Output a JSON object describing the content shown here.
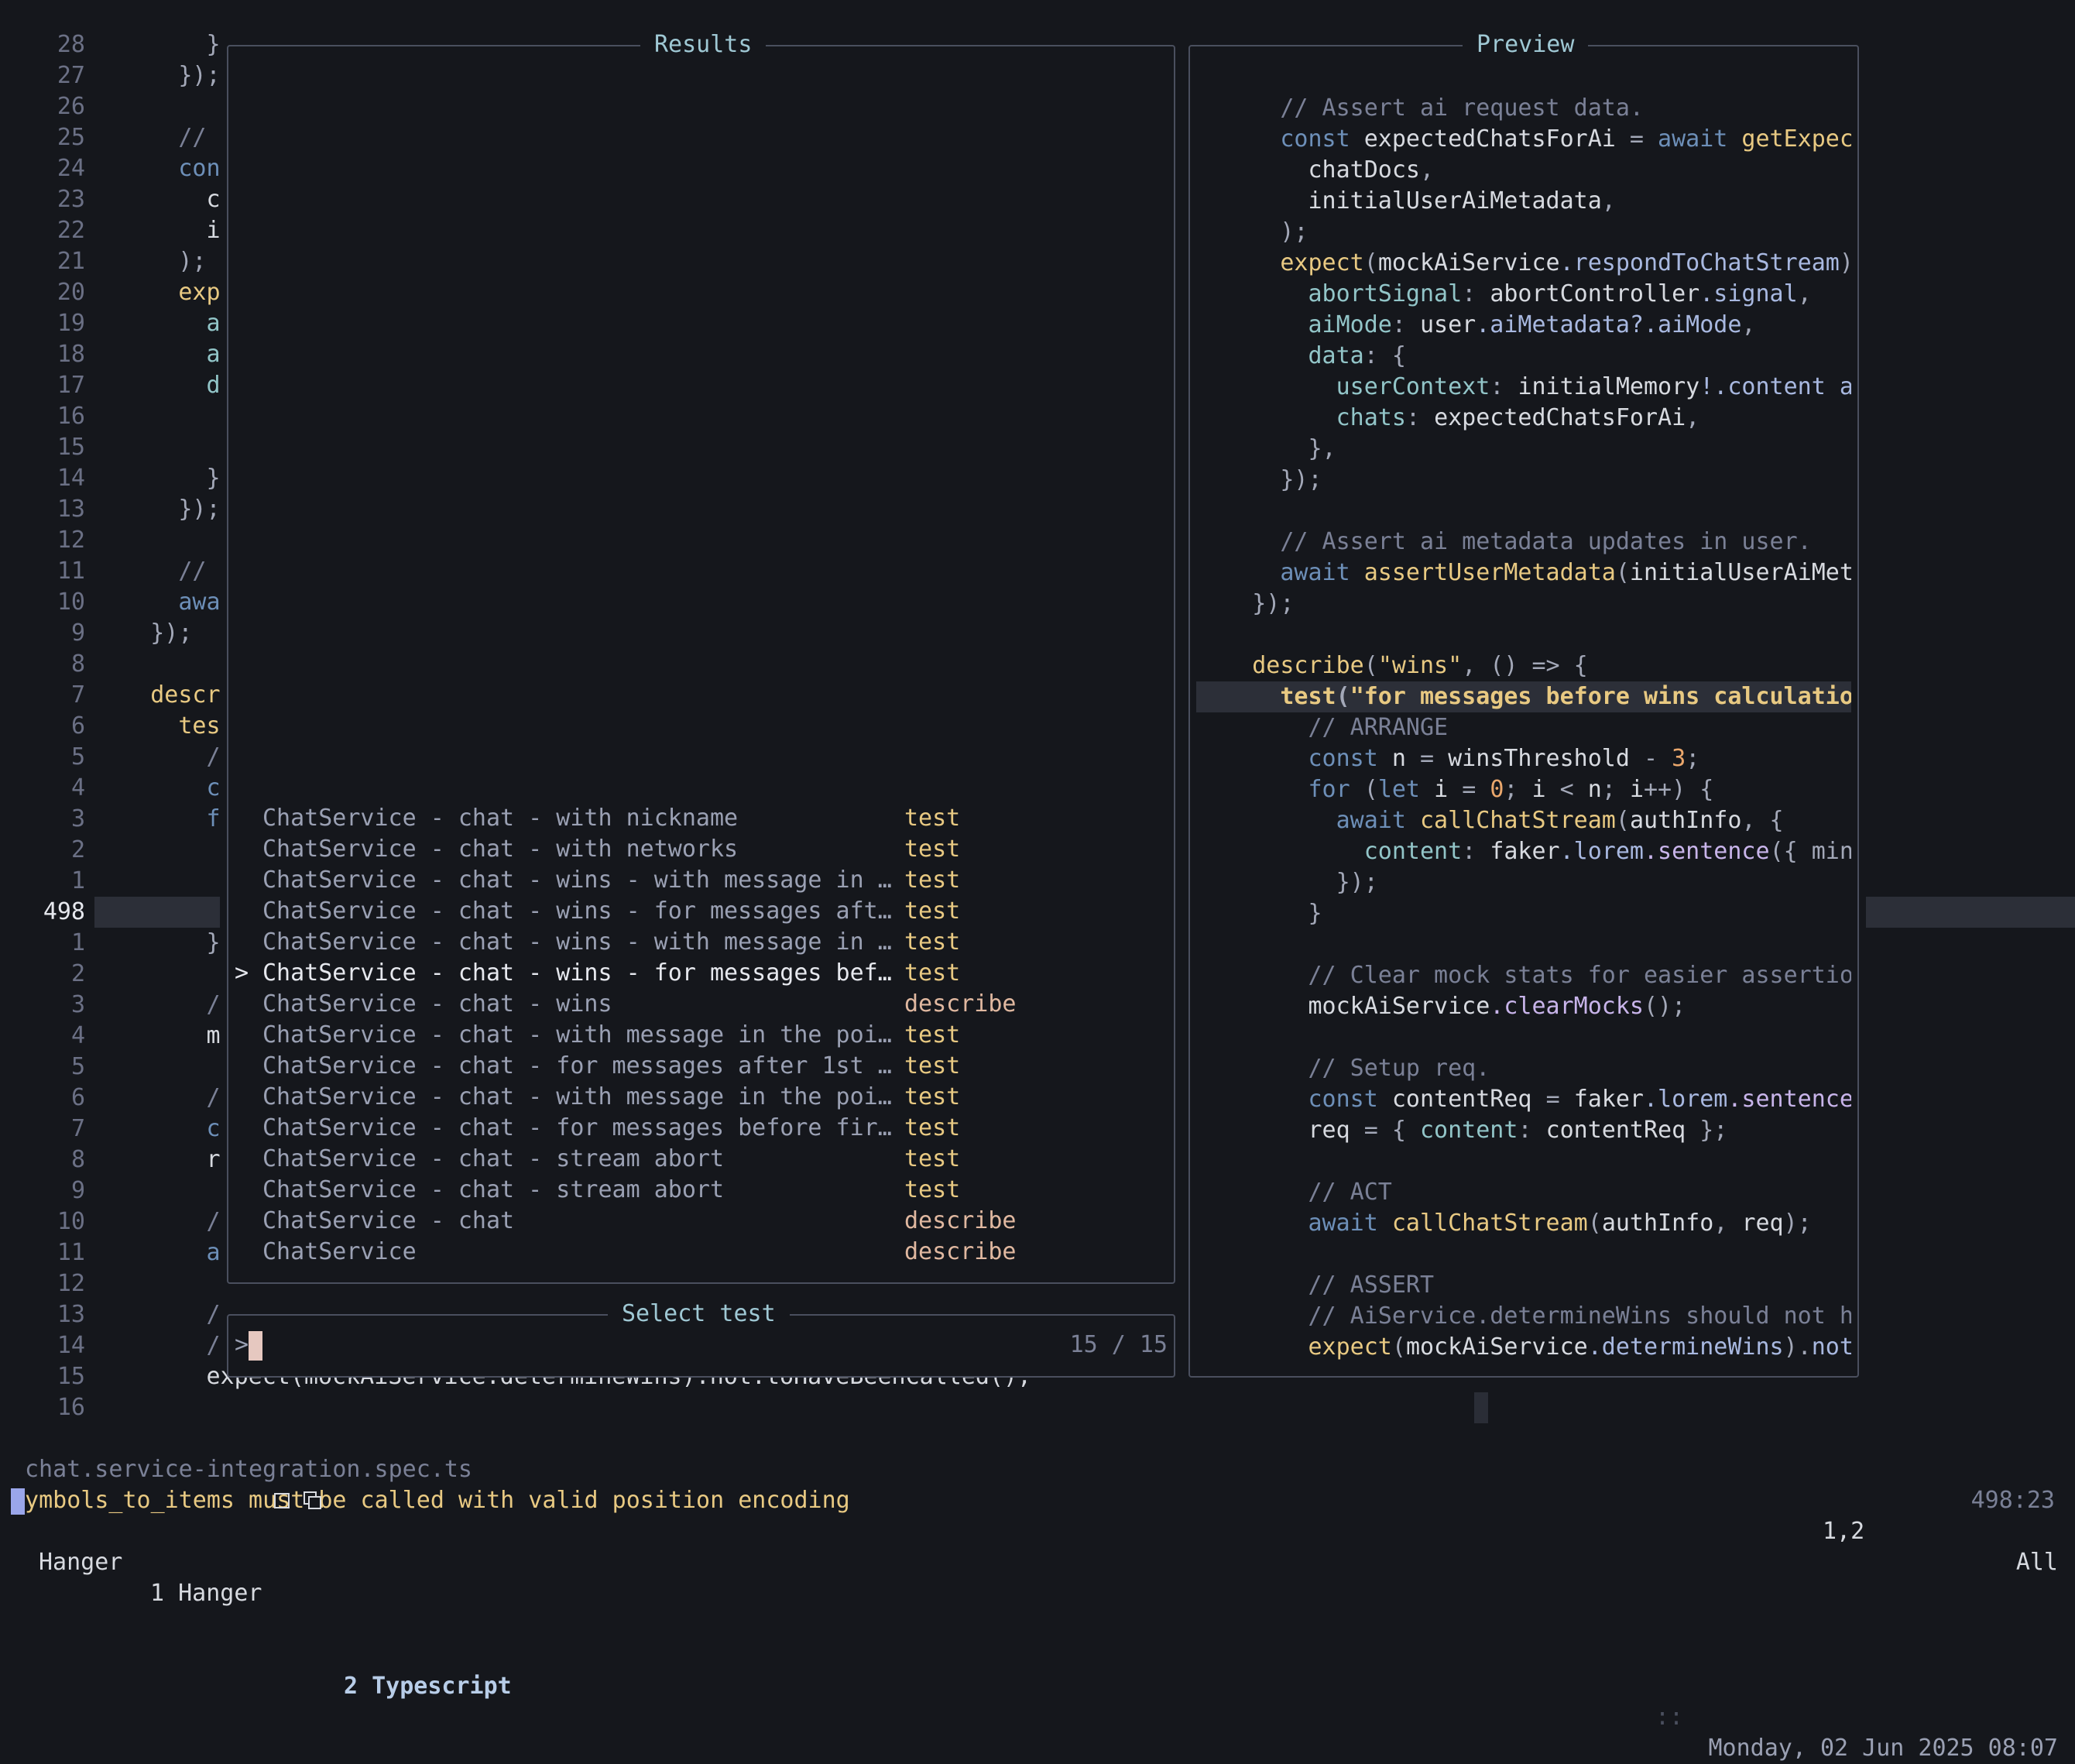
{
  "gutter_lines": [
    "28",
    "27",
    "26",
    "25",
    "24",
    "23",
    "22",
    "21",
    "20",
    "19",
    "18",
    "17",
    "16",
    "15",
    "14",
    "13",
    "12",
    "11",
    "10",
    "9",
    "8",
    "7",
    "6",
    "5",
    "4",
    "3",
    "2",
    "1",
    "498",
    "1",
    "2",
    "3",
    "4",
    "5",
    "6",
    "7",
    "8",
    "9",
    "10",
    "11",
    "12",
    "13",
    "14",
    "15",
    "16"
  ],
  "bg_code": [
    {
      "t": "        }",
      "c": "c-punc"
    },
    {
      "t": "      });",
      "c": "c-punc"
    },
    {
      "t": "",
      "c": ""
    },
    {
      "t": "      //",
      "c": "c-com"
    },
    {
      "t": "      con",
      "c": "c-kw"
    },
    {
      "t": "        c",
      "c": "c-id"
    },
    {
      "t": "        i",
      "c": "c-id"
    },
    {
      "t": "      );",
      "c": "c-punc"
    },
    {
      "t": "      exp",
      "c": "c-fn"
    },
    {
      "t": "        a",
      "c": "c-prop"
    },
    {
      "t": "        a",
      "c": "c-prop"
    },
    {
      "t": "        d",
      "c": "c-prop"
    },
    {
      "t": "",
      "c": ""
    },
    {
      "t": "",
      "c": ""
    },
    {
      "t": "        }",
      "c": "c-punc"
    },
    {
      "t": "      });",
      "c": "c-punc"
    },
    {
      "t": "",
      "c": ""
    },
    {
      "t": "      //",
      "c": "c-com"
    },
    {
      "t": "      awa",
      "c": "c-kw"
    },
    {
      "t": "    });",
      "c": "c-punc"
    },
    {
      "t": "",
      "c": ""
    },
    {
      "t": "    descr",
      "c": "c-fn"
    },
    {
      "t": "      tes",
      "c": "c-fn"
    },
    {
      "t": "        /",
      "c": "c-com"
    },
    {
      "t": "        c",
      "c": "c-kw"
    },
    {
      "t": "        f",
      "c": "c-kw"
    },
    {
      "t": "",
      "c": ""
    },
    {
      "t": "",
      "c": ""
    },
    {
      "t": "",
      "c": ""
    },
    {
      "t": "        }",
      "c": "c-punc"
    },
    {
      "t": "",
      "c": ""
    },
    {
      "t": "        /",
      "c": "c-com"
    },
    {
      "t": "        m",
      "c": "c-id"
    },
    {
      "t": "",
      "c": ""
    },
    {
      "t": "        /",
      "c": "c-com"
    },
    {
      "t": "        c",
      "c": "c-kw"
    },
    {
      "t": "        r",
      "c": "c-id"
    },
    {
      "t": "",
      "c": ""
    },
    {
      "t": "        /",
      "c": "c-com"
    },
    {
      "t": "        a",
      "c": "c-kw"
    },
    {
      "t": "",
      "c": ""
    },
    {
      "t": "        /",
      "c": "c-com"
    },
    {
      "t": "        /",
      "c": "c-com"
    },
    {
      "t": "        expect(mockAiService.determineWins).not.toHaveBeenCalled();",
      "c": "c-id"
    }
  ],
  "results": {
    "title": "Results",
    "items": [
      {
        "name": "ChatService - chat - with nickname",
        "kind": "test",
        "k": "kind-test"
      },
      {
        "name": "ChatService - chat - with networks",
        "kind": "test",
        "k": "kind-test"
      },
      {
        "name": "ChatService - chat - wins - with message in …",
        "kind": "test",
        "k": "kind-test"
      },
      {
        "name": "ChatService - chat - wins - for messages aft…",
        "kind": "test",
        "k": "kind-test"
      },
      {
        "name": "ChatService - chat - wins - with message in …",
        "kind": "test",
        "k": "kind-test"
      },
      {
        "name": "ChatService - chat - wins - for messages bef…",
        "kind": "test",
        "k": "kind-test",
        "selected": true
      },
      {
        "name": "ChatService - chat - wins",
        "kind": "describe",
        "k": "kind-desc"
      },
      {
        "name": "ChatService - chat - with message in the poi…",
        "kind": "test",
        "k": "kind-test"
      },
      {
        "name": "ChatService - chat - for messages after 1st …",
        "kind": "test",
        "k": "kind-test"
      },
      {
        "name": "ChatService - chat - with message in the poi…",
        "kind": "test",
        "k": "kind-test"
      },
      {
        "name": "ChatService - chat - for messages before fir…",
        "kind": "test",
        "k": "kind-test"
      },
      {
        "name": "ChatService - chat - stream abort",
        "kind": "test",
        "k": "kind-test"
      },
      {
        "name": "ChatService - chat - stream abort",
        "kind": "test",
        "k": "kind-test"
      },
      {
        "name": "ChatService - chat",
        "kind": "describe",
        "k": "kind-desc"
      },
      {
        "name": "ChatService",
        "kind": "describe",
        "k": "kind-desc"
      }
    ],
    "selected_marker": ">"
  },
  "prompt": {
    "title": "Select test",
    "prefix": ">",
    "count": "15 / 15"
  },
  "preview": {
    "title": "Preview",
    "lines": [
      [
        [
          "      ",
          ""
        ],
        [
          "// Assert ai request data.",
          "c-com"
        ]
      ],
      [
        [
          "      ",
          ""
        ],
        [
          "const ",
          "c-kw"
        ],
        [
          "expectedChatsForAi ",
          "c-id"
        ],
        [
          "= ",
          "c-punc"
        ],
        [
          "await ",
          "c-kw"
        ],
        [
          "getExpec",
          "c-fn"
        ]
      ],
      [
        [
          "        ",
          ""
        ],
        [
          "chatDocs",
          "c-id"
        ],
        [
          ",",
          "c-punc"
        ]
      ],
      [
        [
          "        ",
          ""
        ],
        [
          "initialUserAiMetadata",
          "c-id"
        ],
        [
          ",",
          "c-punc"
        ]
      ],
      [
        [
          "      ",
          ""
        ],
        [
          ");",
          "c-punc"
        ]
      ],
      [
        [
          "      ",
          ""
        ],
        [
          "expect",
          "c-fn"
        ],
        [
          "(",
          "c-punc"
        ],
        [
          "mockAiService",
          "c-id"
        ],
        [
          ".respondToChatStream",
          "c-mem"
        ],
        [
          ")",
          "c-punc"
        ]
      ],
      [
        [
          "        ",
          ""
        ],
        [
          "abortSignal",
          "c-prop"
        ],
        [
          ": ",
          "c-punc"
        ],
        [
          "abortController",
          "c-id"
        ],
        [
          ".signal",
          "c-mem"
        ],
        [
          ",",
          "c-punc"
        ]
      ],
      [
        [
          "        ",
          ""
        ],
        [
          "aiMode",
          "c-prop"
        ],
        [
          ": ",
          "c-punc"
        ],
        [
          "user",
          "c-id"
        ],
        [
          ".aiMetadata?.aiMode",
          "c-mem"
        ],
        [
          ",",
          "c-punc"
        ]
      ],
      [
        [
          "        ",
          ""
        ],
        [
          "data",
          "c-prop"
        ],
        [
          ": {",
          "c-punc"
        ]
      ],
      [
        [
          "          ",
          ""
        ],
        [
          "userContext",
          "c-prop"
        ],
        [
          ": ",
          "c-punc"
        ],
        [
          "initialMemory",
          "c-id"
        ],
        [
          "!.content a",
          "c-mem"
        ]
      ],
      [
        [
          "          ",
          ""
        ],
        [
          "chats",
          "c-prop"
        ],
        [
          ": ",
          "c-punc"
        ],
        [
          "expectedChatsForAi",
          "c-id"
        ],
        [
          ",",
          "c-punc"
        ]
      ],
      [
        [
          "        ",
          ""
        ],
        [
          "},",
          "c-punc"
        ]
      ],
      [
        [
          "      ",
          ""
        ],
        [
          "});",
          "c-punc"
        ]
      ],
      [
        [
          "",
          ""
        ]
      ],
      [
        [
          "      ",
          ""
        ],
        [
          "// Assert ai metadata updates in user.",
          "c-com"
        ]
      ],
      [
        [
          "      ",
          ""
        ],
        [
          "await ",
          "c-kw"
        ],
        [
          "assertUserMetadata",
          "c-fn"
        ],
        [
          "(",
          "c-punc"
        ],
        [
          "initialUserAiMet",
          "c-id"
        ]
      ],
      [
        [
          "    ",
          ""
        ],
        [
          "});",
          "c-punc"
        ]
      ],
      [
        [
          "",
          ""
        ]
      ],
      [
        [
          "    ",
          ""
        ],
        [
          "describe",
          "c-fn"
        ],
        [
          "(",
          "c-punc"
        ],
        [
          "\"wins\"",
          "c-str"
        ],
        [
          ", () => {",
          "c-punc"
        ]
      ],
      [
        [
          "      ",
          ""
        ],
        [
          "test",
          "c-fn"
        ],
        [
          "(",
          "c-punc"
        ],
        [
          "\"for messages before wins calculatio",
          "c-str"
        ]
      ],
      [
        [
          "        ",
          ""
        ],
        [
          "// ARRANGE",
          "c-com"
        ]
      ],
      [
        [
          "        ",
          ""
        ],
        [
          "const ",
          "c-kw"
        ],
        [
          "n ",
          "c-id"
        ],
        [
          "= ",
          "c-punc"
        ],
        [
          "winsThreshold ",
          "c-id"
        ],
        [
          "- ",
          "c-punc"
        ],
        [
          "3",
          "c-num"
        ],
        [
          ";",
          "c-punc"
        ]
      ],
      [
        [
          "        ",
          ""
        ],
        [
          "for ",
          "c-kw"
        ],
        [
          "(",
          "c-punc"
        ],
        [
          "let ",
          "c-kw"
        ],
        [
          "i ",
          "c-id"
        ],
        [
          "= ",
          "c-punc"
        ],
        [
          "0",
          "c-num"
        ],
        [
          "; ",
          "c-punc"
        ],
        [
          "i ",
          "c-id"
        ],
        [
          "< ",
          "c-punc"
        ],
        [
          "n",
          "c-id"
        ],
        [
          "; ",
          "c-punc"
        ],
        [
          "i",
          "c-id"
        ],
        [
          "++) {",
          "c-punc"
        ]
      ],
      [
        [
          "          ",
          ""
        ],
        [
          "await ",
          "c-kw"
        ],
        [
          "callChatStream",
          "c-fn"
        ],
        [
          "(",
          "c-punc"
        ],
        [
          "authInfo",
          "c-id"
        ],
        [
          ", {",
          "c-punc"
        ]
      ],
      [
        [
          "            ",
          ""
        ],
        [
          "content",
          "c-prop"
        ],
        [
          ": ",
          "c-punc"
        ],
        [
          "faker",
          "c-id"
        ],
        [
          ".lorem",
          "c-mem"
        ],
        [
          ".sentence",
          "c-key"
        ],
        [
          "({ min",
          "c-punc"
        ]
      ],
      [
        [
          "          ",
          ""
        ],
        [
          "});",
          "c-punc"
        ]
      ],
      [
        [
          "        ",
          ""
        ],
        [
          "}",
          "c-punc"
        ]
      ],
      [
        [
          "",
          ""
        ]
      ],
      [
        [
          "        ",
          ""
        ],
        [
          "// Clear mock stats for easier assertio",
          "c-com"
        ]
      ],
      [
        [
          "        ",
          ""
        ],
        [
          "mockAiService",
          "c-id"
        ],
        [
          ".clearMocks",
          "c-key"
        ],
        [
          "();",
          "c-punc"
        ]
      ],
      [
        [
          "",
          ""
        ]
      ],
      [
        [
          "        ",
          ""
        ],
        [
          "// Setup req.",
          "c-com"
        ]
      ],
      [
        [
          "        ",
          ""
        ],
        [
          "const ",
          "c-kw"
        ],
        [
          "contentReq ",
          "c-id"
        ],
        [
          "= ",
          "c-punc"
        ],
        [
          "faker",
          "c-id"
        ],
        [
          ".lorem",
          "c-mem"
        ],
        [
          ".sentence",
          "c-key"
        ]
      ],
      [
        [
          "        ",
          ""
        ],
        [
          "req ",
          "c-id"
        ],
        [
          "= { ",
          "c-punc"
        ],
        [
          "content",
          "c-prop"
        ],
        [
          ": ",
          "c-punc"
        ],
        [
          "contentReq ",
          "c-id"
        ],
        [
          "};",
          "c-punc"
        ]
      ],
      [
        [
          "",
          ""
        ]
      ],
      [
        [
          "        ",
          ""
        ],
        [
          "// ACT",
          "c-com"
        ]
      ],
      [
        [
          "        ",
          ""
        ],
        [
          "await ",
          "c-kw"
        ],
        [
          "callChatStream",
          "c-fn"
        ],
        [
          "(",
          "c-punc"
        ],
        [
          "authInfo",
          "c-id"
        ],
        [
          ", ",
          "c-punc"
        ],
        [
          "req",
          "c-id"
        ],
        [
          ");",
          "c-punc"
        ]
      ],
      [
        [
          "",
          ""
        ]
      ],
      [
        [
          "        ",
          ""
        ],
        [
          "// ASSERT",
          "c-com"
        ]
      ],
      [
        [
          "        ",
          ""
        ],
        [
          "// AiService.determineWins should not h",
          "c-com"
        ]
      ],
      [
        [
          "        ",
          ""
        ],
        [
          "expect",
          "c-fn"
        ],
        [
          "(",
          "c-punc"
        ],
        [
          "mockAiService",
          "c-id"
        ],
        [
          ".determineWins",
          "c-mem"
        ],
        [
          ").",
          "c-punc"
        ],
        [
          "not",
          "c-mem"
        ]
      ]
    ],
    "highlight_index": 19
  },
  "statusline": {
    "filename": "chat.service-integration.spec.ts",
    "position": "498:23",
    "message": "symbols_to_items must be called with valid position encoding",
    "cursor_pos": "1,2",
    "scroll": "All",
    "session": "Hanger",
    "window1": "1 Hanger",
    "window2": "2 Typescript",
    "separator": "::",
    "datetime": "Monday, 02 Jun 2025 08:07"
  }
}
